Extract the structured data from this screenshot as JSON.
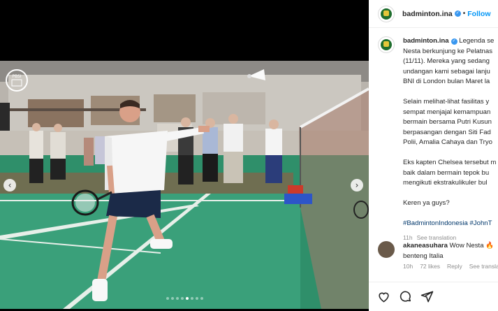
{
  "post": {
    "username": "badminton.ina",
    "follow_label": "Follow",
    "separator": "•"
  },
  "caption": {
    "username": "badminton.ina",
    "lines": [
      "Legenda se",
      "Nesta berkunjung ke Pelatnas",
      "(11/11). Mereka yang sedang",
      "undangan kami sebagai lanju",
      "BNI di London bulan Maret la"
    ],
    "para2": [
      "Selain melihat-lihat fasilitas y",
      "sempat menjajal kemampuan",
      "bermain bersama Putri Kusun",
      "berpasangan dengan Siti Fad",
      "Polii, Amalia Cahaya dan Tryo"
    ],
    "para3": [
      "Eks kapten Chelsea tersebut m",
      "baik dalam bermain tepok bu",
      "mengikuti ekstrakulikuler bul"
    ],
    "para4": "Keren ya guys?",
    "hashtags": "#BadmintonIndonesia #JohnT",
    "time": "11h",
    "see_translation": "See translation"
  },
  "comment": {
    "username": "akaneasuhara",
    "text_line1": "Wow Nesta",
    "emoji": "🔥",
    "text_line2": "benteng Italia",
    "time": "10h",
    "likes": "72 likes",
    "reply": "Reply",
    "see_translation": "See transla"
  },
  "media": {
    "badge_text": "PBSI",
    "dots_count": 8,
    "active_dot": 5
  },
  "colors": {
    "court": "#2f8f6a",
    "link": "#0095f6",
    "hashtag": "#00376b"
  }
}
